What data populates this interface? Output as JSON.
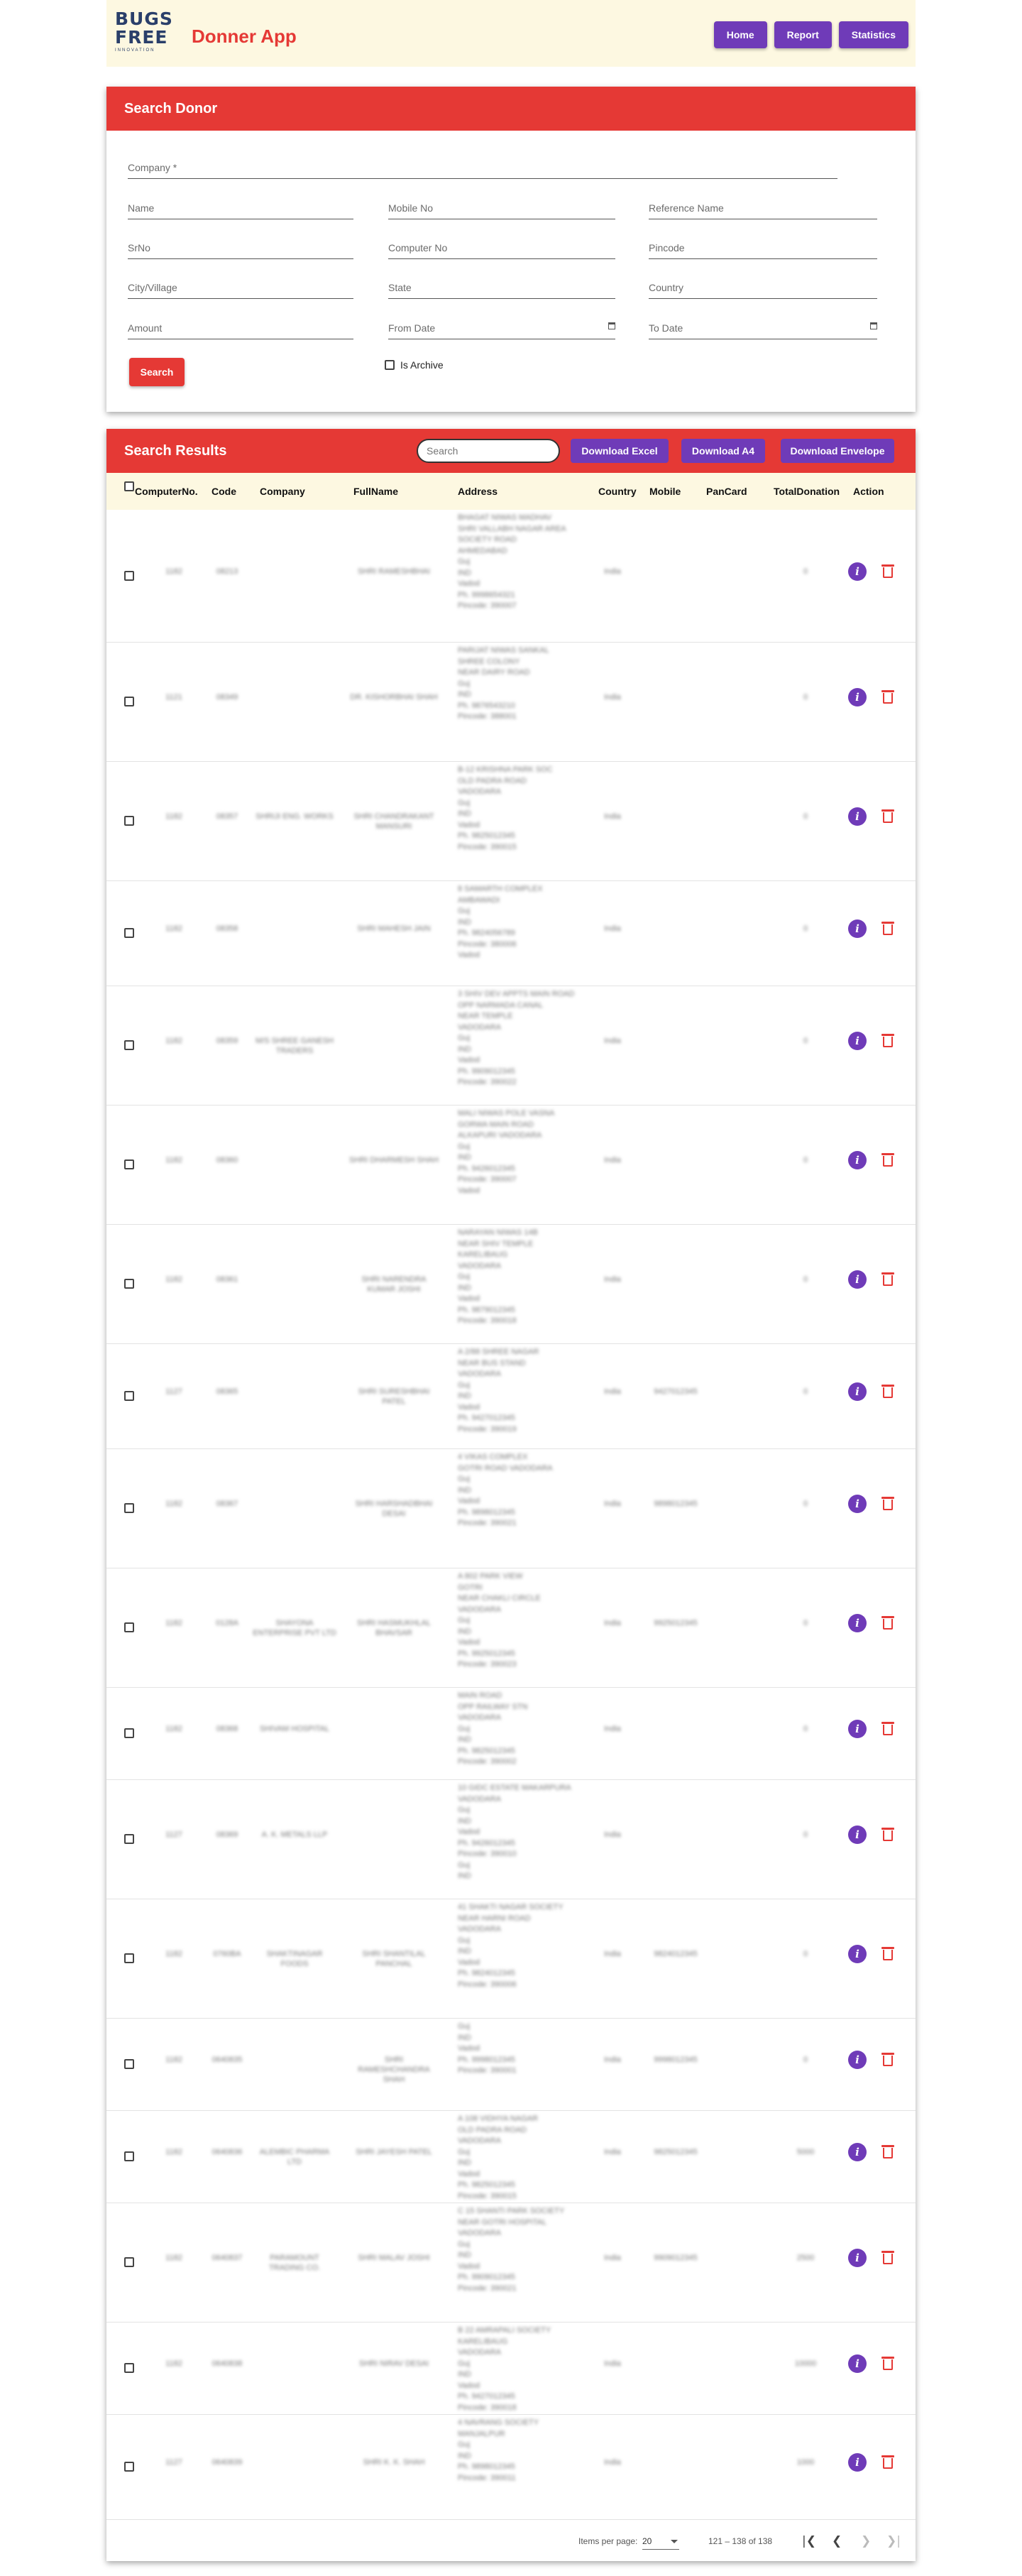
{
  "header": {
    "logo": {
      "line1": "BUGS",
      "line2": "FREE",
      "line3": "INNOVATION"
    },
    "app_title": "Donner App",
    "nav": [
      "Home",
      "Report",
      "Statistics"
    ]
  },
  "search_form": {
    "title": "Search Donor",
    "company_label": "Company *",
    "fields": {
      "name": "Name",
      "mobile": "Mobile No",
      "reference": "Reference Name",
      "srno": "SrNo",
      "computer_no": "Computer No",
      "pincode": "Pincode",
      "city": "City/Village",
      "state": "State",
      "country": "Country",
      "amount": "Amount",
      "from_date": "From Date",
      "to_date": "To Date"
    },
    "search_button": "Search",
    "archive_label": "Is Archive"
  },
  "results": {
    "title": "Search Results",
    "search_placeholder": "Search",
    "buttons": {
      "excel": "Download Excel",
      "a4": "Download A4",
      "envelope": "Download Envelope"
    },
    "columns": {
      "computer_no": "ComputerNo.",
      "code": "Code",
      "company": "Company",
      "fullname": "FullName",
      "address": "Address",
      "country": "Country",
      "mobile": "Mobile",
      "pancard": "PanCard",
      "total": "TotalDonation",
      "action": "Action"
    },
    "rows": [
      {
        "computer_no": "1182",
        "code": "08213",
        "company": "",
        "fullname": "SHRI RAMESHBHAI",
        "address": [
          "BHAGAT NIWAS MADHAV",
          "SHRI VALLABH NAGAR AREA",
          "SOCIETY ROAD",
          "AHMEDABAD",
          "Guj",
          "IND",
          "Vadod",
          "Ph. 9998654321",
          "Pincode: 390007"
        ],
        "country": "India",
        "mobile": "",
        "pancard": "",
        "total": "0"
      },
      {
        "computer_no": "1121",
        "code": "08349",
        "company": "",
        "fullname": "DR. KISHORBHAI SHAH",
        "address": [
          "PARIJAT NIWAS SANKAL",
          "SHREE COLONY",
          "NEAR DAIRY ROAD",
          "Guj",
          "IND",
          "Ph. 9876543210",
          "Pincode: 388001"
        ],
        "country": "India",
        "mobile": "",
        "pancard": "",
        "total": "0"
      },
      {
        "computer_no": "1182",
        "code": "08357",
        "company": "SHRIJI ENG. WORKS",
        "fullname": "SHRI CHANDRAKANT MANSURI",
        "address": [
          "B-12 KRISHNA PARK SOC",
          "OLD PADRA ROAD",
          "VADODARA",
          "Guj",
          "IND",
          "Vadod",
          "Ph. 9825012345",
          "Pincode: 390015"
        ],
        "country": "India",
        "mobile": "",
        "pancard": "",
        "total": "0"
      },
      {
        "computer_no": "1182",
        "code": "08358",
        "company": "",
        "fullname": "SHRI MAHESH JAIN",
        "address": [
          "8 SAMARTH COMPLEX",
          "AMBAWADI",
          "Guj",
          "IND",
          "Ph. 9824056789",
          "Pincode: 380006",
          "Vadod"
        ],
        "country": "India",
        "mobile": "",
        "pancard": "",
        "total": "0"
      },
      {
        "computer_no": "1182",
        "code": "08359",
        "company": "M/S SHREE GANESH TRADERS",
        "fullname": "",
        "address": [
          "3 SHIV DEV APPTS MAIN ROAD",
          "OPP NARMADA CANAL",
          "NEAR TEMPLE",
          "VADODARA",
          "Guj",
          "IND",
          "Vadod",
          "Ph. 9909012345",
          "Pincode: 390022"
        ],
        "country": "India",
        "mobile": "",
        "pancard": "",
        "total": "0"
      },
      {
        "computer_no": "1182",
        "code": "08360",
        "company": "",
        "fullname": "SHRI DHARMESH SHAH",
        "address": [
          "MALI NIWAS POLE VASNA",
          "GORWA MAIN ROAD",
          "ALKAPURI VADODARA",
          "Guj",
          "IND",
          "Ph. 9426012345",
          "Pincode: 390007",
          "Vadod"
        ],
        "country": "India",
        "mobile": "",
        "pancard": "",
        "total": "0"
      },
      {
        "computer_no": "1182",
        "code": "08361",
        "company": "",
        "fullname": "SHRI NARENDRA KUMAR JOSHI",
        "address": [
          "NARAYAN NIWAS 14B",
          "NEAR SHIV TEMPLE",
          "KARELIBAUG",
          "VADODARA",
          "Guj",
          "IND",
          "Vadod",
          "Ph. 9879012345",
          "Pincode: 390018"
        ],
        "country": "India",
        "mobile": "",
        "pancard": "",
        "total": "0"
      },
      {
        "computer_no": "1127",
        "code": "08365",
        "company": "",
        "fullname": "SHRI SURESHBHAI PATEL",
        "address": [
          "A 2/88 SHREE NAGAR",
          "NEAR BUS STAND",
          "VADODARA",
          "Guj",
          "IND",
          "Vadod",
          "Ph. 9427012345",
          "Pincode: 390019"
        ],
        "country": "India",
        "mobile": "9427012345",
        "pancard": "",
        "total": "0"
      },
      {
        "computer_no": "1182",
        "code": "08367",
        "company": "",
        "fullname": "SHRI HARSHADBHAI DESAI",
        "address": [
          "4 VIKAS COMPLEX",
          "GOTRI ROAD VADODARA",
          "Guj",
          "IND",
          "Vadod",
          "Ph. 9898012345",
          "Pincode: 390021"
        ],
        "country": "India",
        "mobile": "9898012345",
        "pancard": "",
        "total": "0"
      },
      {
        "computer_no": "1182",
        "code": "0128A",
        "company": "SHAYONA ENTERPRISE PVT LTD",
        "fullname": "SHRI HASMUKHLAL BHAVSAR",
        "address": [
          "A 802 PARK VIEW",
          "GOTRI",
          "NEAR CHAKLI CIRCLE",
          "VADODARA",
          "Guj",
          "IND",
          "Vadod",
          "Ph. 9925012345",
          "Pincode: 390023"
        ],
        "country": "India",
        "mobile": "9925012345",
        "pancard": "",
        "total": "0"
      },
      {
        "computer_no": "1182",
        "code": "08368",
        "company": "SHIVAM HOSPITAL",
        "fullname": "",
        "address": [
          "MAIN ROAD",
          "OPP RAILWAY STN",
          "VADODARA",
          "Guj",
          "IND",
          "Ph. 9825012345",
          "Pincode: 390002"
        ],
        "country": "India",
        "mobile": "",
        "pancard": "",
        "total": "0"
      },
      {
        "computer_no": "1127",
        "code": "08369",
        "company": "A. K. METALS LLP",
        "fullname": "",
        "address": [
          "10 GIDC ESTATE MAKARPURA",
          "VADODARA",
          "Guj",
          "IND",
          "Vadod",
          "Ph. 9426012345",
          "Pincode: 390010",
          "Guj",
          "IND"
        ],
        "country": "India",
        "mobile": "",
        "pancard": "",
        "total": "0"
      },
      {
        "computer_no": "1182",
        "code": "0760BA",
        "company": "SHAKTINAGAR FOODS",
        "fullname": "SHRI SHANTILAL PANCHAL",
        "address": [
          "41 SHAKTI NAGAR SOCIETY",
          "NEAR HARNI ROAD",
          "VADODARA",
          "Guj",
          "IND",
          "Vadod",
          "Ph. 9824012345",
          "Pincode: 390006"
        ],
        "country": "India",
        "mobile": "9824012345",
        "pancard": "",
        "total": "0"
      },
      {
        "computer_no": "1182",
        "code": "0640835",
        "company": "",
        "fullname": "SHRI RAMESHCHANDRA SHAH",
        "address": [
          "Guj",
          "IND",
          "Vadod",
          "Ph. 9998012345",
          "Pincode: 390001"
        ],
        "country": "India",
        "mobile": "9998012345",
        "pancard": "",
        "total": "0"
      },
      {
        "computer_no": "1182",
        "code": "0640836",
        "company": "ALEMBIC PHARMA LTD",
        "fullname": "SHRI JAYESH PATEL",
        "address": [
          "A 108 VIDHYA NAGAR",
          "OLD PADRA ROAD",
          "VADODARA",
          "Guj",
          "IND",
          "Vadod",
          "Ph. 9825012345",
          "Pincode: 390015"
        ],
        "country": "India",
        "mobile": "9825012345",
        "pancard": "",
        "total": "5000"
      },
      {
        "computer_no": "1182",
        "code": "0640837",
        "company": "PARAMOUNT TRADING CO.",
        "fullname": "SHRI MALAV JOSHI",
        "address": [
          "C 15 SHANTI PARK SOCIETY",
          "NEAR GOTRI HOSPITAL",
          "VADODARA",
          "Guj",
          "IND",
          "Vadod",
          "Ph. 9909012345",
          "Pincode: 390021"
        ],
        "country": "India",
        "mobile": "9909012345",
        "pancard": "",
        "total": "2500"
      },
      {
        "computer_no": "1182",
        "code": "0640838",
        "company": "",
        "fullname": "SHRI NIRAV DESAI",
        "address": [
          "B 22 AMRAPALI SOCIETY",
          "KARELIBAUG",
          "VADODARA",
          "Guj",
          "IND",
          "Vadod",
          "Ph. 9427012345",
          "Pincode: 390018"
        ],
        "country": "India",
        "mobile": "",
        "pancard": "",
        "total": "10000"
      },
      {
        "computer_no": "1127",
        "code": "0640839",
        "company": "",
        "fullname": "SHRI K. K. SHAH",
        "address": [
          "4 NAVRANG SOCIETY",
          "MANJALPUR",
          "Guj",
          "IND",
          "Ph. 9898012345",
          "Pincode: 390011"
        ],
        "country": "India",
        "mobile": "",
        "pancard": "",
        "total": "1000"
      }
    ],
    "pagination": {
      "items_per_page_label": "Items per page:",
      "page_size": "20",
      "range": "121 – 138 of 138"
    }
  }
}
